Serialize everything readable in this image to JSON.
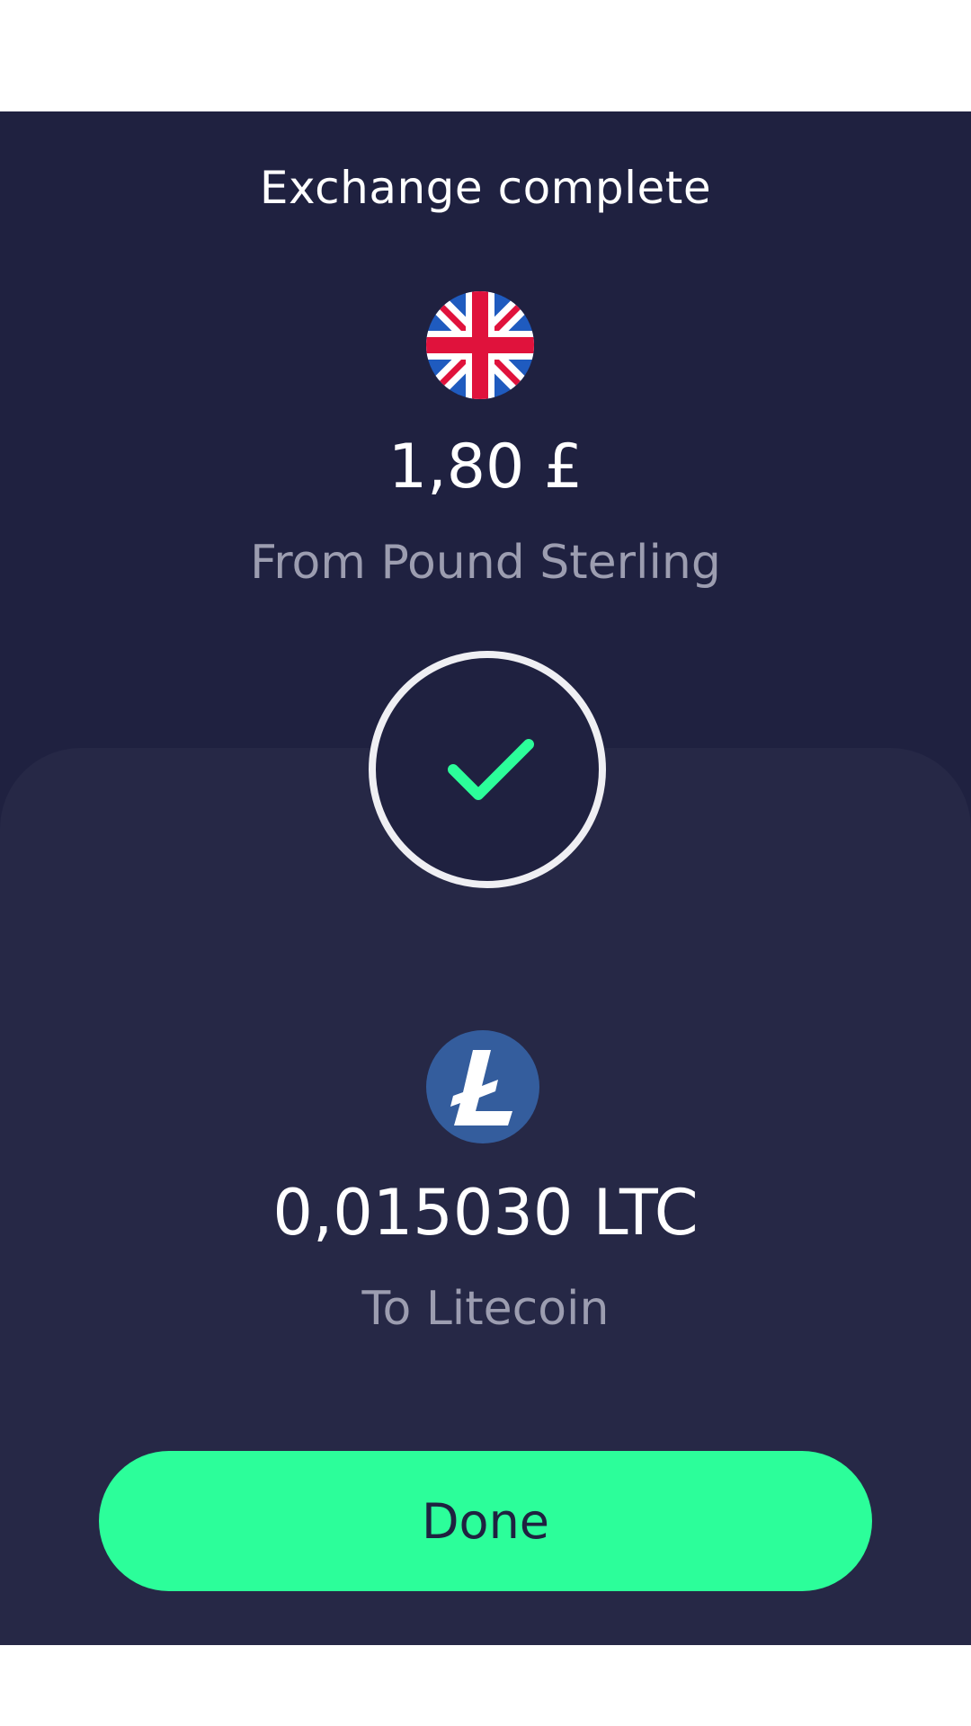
{
  "header": {
    "title": "Exchange complete"
  },
  "from": {
    "icon": "uk-flag-icon",
    "amount": "1,80 £",
    "label": "From Pound Sterling"
  },
  "status": {
    "icon": "checkmark-icon",
    "color": "#2cfe9a"
  },
  "to": {
    "icon": "litecoin-icon",
    "amount": "0,015030 LTC",
    "label": "To Litecoin"
  },
  "actions": {
    "done_label": "Done"
  },
  "colors": {
    "background": "#1f2140",
    "panel": "#262846",
    "accent": "#2cfe9a",
    "muted_text": "#9c9db0"
  }
}
